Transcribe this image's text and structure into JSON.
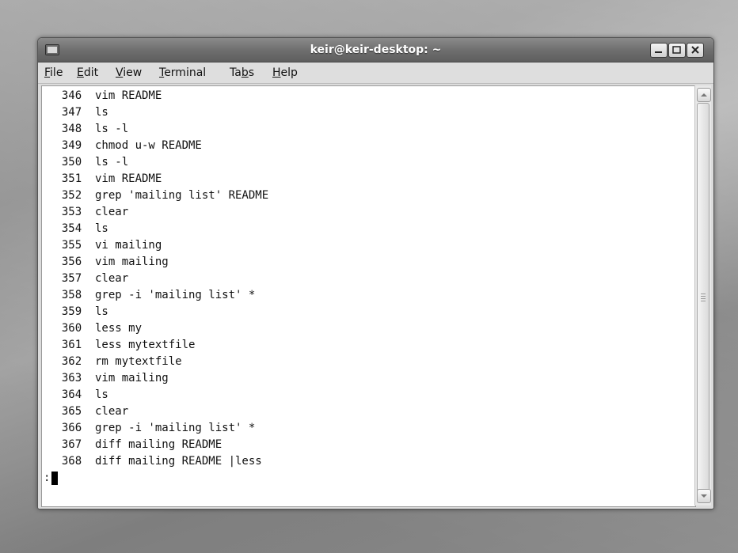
{
  "window": {
    "title": "keir@keir-desktop: ~"
  },
  "menu": [
    {
      "pre": "",
      "acc": "F",
      "post": "ile"
    },
    {
      "pre": "",
      "acc": "E",
      "post": "dit"
    },
    {
      "pre": "",
      "acc": "V",
      "post": "iew"
    },
    {
      "pre": "",
      "acc": "T",
      "post": "erminal"
    },
    {
      "pre": "Ta",
      "acc": "b",
      "post": "s"
    },
    {
      "pre": "",
      "acc": "H",
      "post": "elp"
    }
  ],
  "terminal": {
    "lines": [
      "  346  vim README",
      "  347  ls",
      "  348  ls -l",
      "  349  chmod u-w README",
      "  350  ls -l",
      "  351  vim README",
      "  352  grep 'mailing list' README",
      "  353  clear",
      "  354  ls",
      "  355  vi mailing",
      "  356  vim mailing",
      "  357  clear",
      "  358  grep -i 'mailing list' *",
      "  359  ls",
      "  360  less my",
      "  361  less mytextfile",
      "  362  rm mytextfile",
      "  363  vim mailing",
      "  364  ls",
      "  365  clear",
      "  366  grep -i 'mailing list' *",
      "  367  diff mailing README",
      "  368  diff mailing README |less"
    ],
    "prompt": ":"
  },
  "icons": {
    "window_icon": "terminal-window-icon",
    "minimize": "minimize-icon",
    "maximize": "maximize-icon",
    "close": "close-icon",
    "scroll_up": "arrow-up-icon",
    "scroll_down": "arrow-down-icon"
  }
}
